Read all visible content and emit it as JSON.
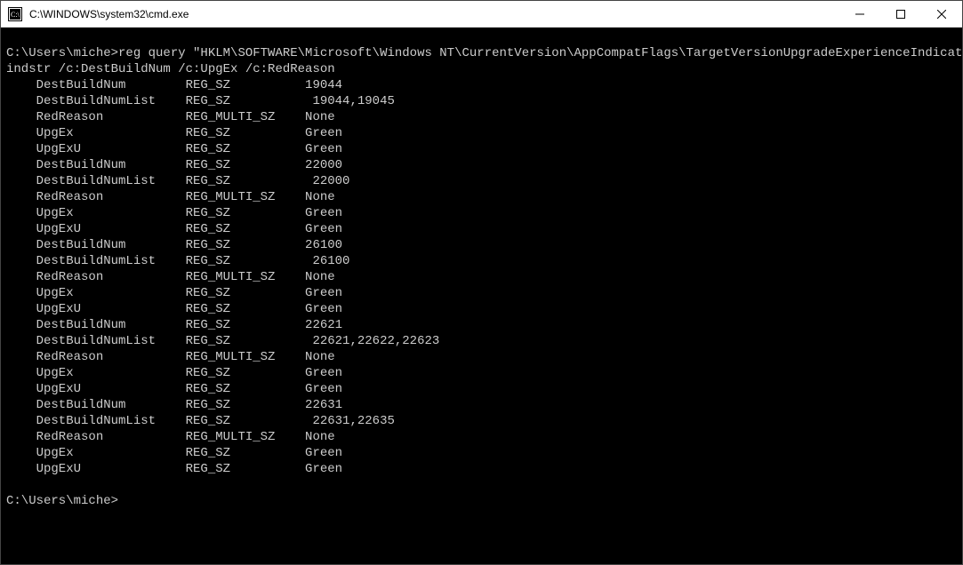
{
  "window": {
    "title": "C:\\WINDOWS\\system32\\cmd.exe"
  },
  "terminal": {
    "prompt": "C:\\Users\\miche>",
    "command": "reg query \"HKLM\\SOFTWARE\\Microsoft\\Windows NT\\CurrentVersion\\AppCompatFlags\\TargetVersionUpgradeExperienceIndicators\" /s | findstr /c:DestBuildNum /c:UpgEx /c:RedReason",
    "groups": [
      {
        "DestBuildNum": "19044",
        "DestBuildNumList": "19044,19045",
        "RedReason": "None",
        "UpgEx": "Green",
        "UpgExU": "Green"
      },
      {
        "DestBuildNum": "22000",
        "DestBuildNumList": "22000",
        "RedReason": "None",
        "UpgEx": "Green",
        "UpgExU": "Green"
      },
      {
        "DestBuildNum": "26100",
        "DestBuildNumList": "26100",
        "RedReason": "None",
        "UpgEx": "Green",
        "UpgExU": "Green"
      },
      {
        "DestBuildNum": "22621",
        "DestBuildNumList": "22621,22622,22623",
        "RedReason": "None",
        "UpgEx": "Green",
        "UpgExU": "Green"
      },
      {
        "DestBuildNum": "22631",
        "DestBuildNumList": "22631,22635",
        "RedReason": "None",
        "UpgEx": "Green",
        "UpgExU": "Green"
      }
    ],
    "types": {
      "DestBuildNum": "REG_SZ",
      "DestBuildNumList": "REG_SZ",
      "RedReason": "REG_MULTI_SZ",
      "UpgEx": "REG_SZ",
      "UpgExU": "REG_SZ"
    },
    "final_prompt": "C:\\Users\\miche>"
  }
}
